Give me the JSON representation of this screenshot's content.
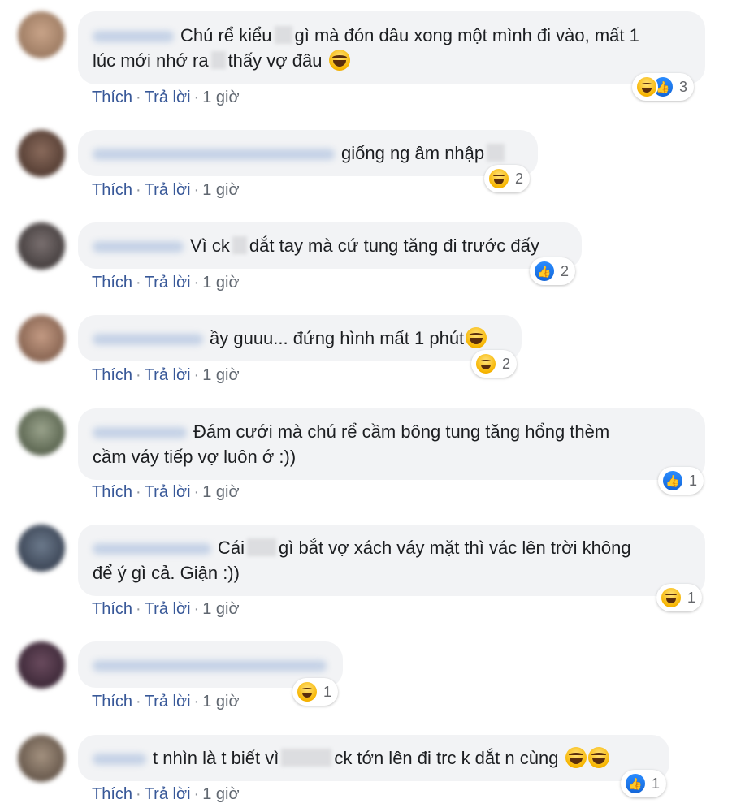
{
  "actions": {
    "like": "Thích",
    "reply": "Trả lời",
    "sep": "·"
  },
  "comments": [
    {
      "lines": [
        [
          "Chú rể kiểu",
          "gì mà đón dâu xong một mình đi vào, mất 1"
        ],
        [
          "lúc mới nhớ ra",
          "thấy vợ đâu"
        ]
      ],
      "time": "1 giờ",
      "reactions": {
        "icons": [
          "haha-icon",
          "like-icon"
        ],
        "count": "3"
      }
    },
    {
      "text": "giống ng âm nhập",
      "time": "1 giờ",
      "reactions": {
        "icons": [
          "haha-icon"
        ],
        "count": "2"
      }
    },
    {
      "text_a": "Vì ck",
      "text_b": "dắt tay mà cứ tung tăng đi trước đấy",
      "time": "1 giờ",
      "reactions": {
        "icons": [
          "like-icon"
        ],
        "count": "2"
      }
    },
    {
      "text": "ầy guuu... đứng hình mất 1 phút",
      "time": "1 giờ",
      "reactions": {
        "icons": [
          "haha-icon"
        ],
        "count": "2"
      }
    },
    {
      "line1": "Đám cưới mà chú rể cầm bông tung tăng hổng thèm",
      "line2": "cầm váy tiếp vợ luôn ớ :))",
      "time": "1 giờ",
      "reactions": {
        "icons": [
          "like-icon"
        ],
        "count": "1"
      }
    },
    {
      "text_a": "Cái",
      "text_b": "gì bắt vợ xách váy mặt thì vác lên trời không",
      "line2": "để ý gì cả. Giận :))",
      "time": "1 giờ",
      "reactions": {
        "icons": [
          "haha-icon"
        ],
        "count": "1"
      }
    },
    {
      "time": "1 giờ",
      "reactions": {
        "icons": [
          "haha-icon"
        ],
        "count": "1"
      }
    },
    {
      "text_a": "t nhìn là t biết vì",
      "text_b": "ck tớn lên đi trc k dắt n cùng",
      "time": "1 giờ",
      "reactions": {
        "icons": [
          "like-icon"
        ],
        "count": "1"
      }
    }
  ]
}
